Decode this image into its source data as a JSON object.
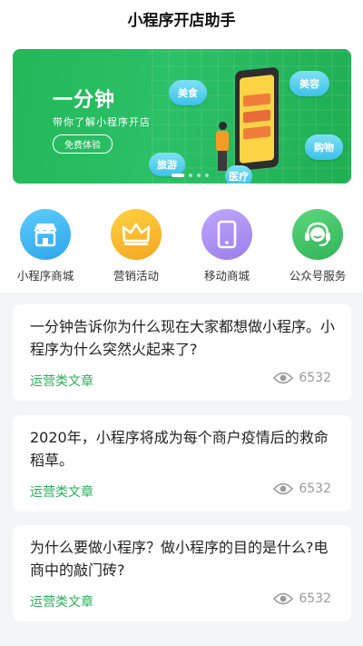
{
  "app": {
    "title": "小程序开店助手"
  },
  "banner": {
    "headline": "一分钟",
    "subline": "带你了解小程序开店",
    "cta": "免费体验",
    "clouds": [
      "美食",
      "美容",
      "购物",
      "旅游",
      "医疗"
    ],
    "slide_count": 4,
    "active_slide": 0
  },
  "menu": [
    {
      "label": "小程序商城",
      "icon": "store-icon",
      "color": "#3bb6f2"
    },
    {
      "label": "营销活动",
      "icon": "crown-icon",
      "color": "#f7b71e"
    },
    {
      "label": "移动商城",
      "icon": "phone-icon",
      "color": "#a98cf0"
    },
    {
      "label": "公众号服务",
      "icon": "headset-icon",
      "color": "#3cc262"
    }
  ],
  "articles": [
    {
      "text": "一分钟告诉你为什么现在大家都想做小程序。小程序为什么突然火起来了?",
      "category": "运营类文章",
      "views": "6532"
    },
    {
      "text": "2020年，小程序将成为每个商户疫情后的救命稻草。",
      "category": "运营类文章",
      "views": "6532"
    },
    {
      "text": "为什么要做小程序？做小程序的目的是什么?电商中的敲门砖?",
      "category": "运营类文章",
      "views": "6532"
    }
  ],
  "colors": {
    "accent": "#2bb05c",
    "muted": "#9a9a9a"
  }
}
